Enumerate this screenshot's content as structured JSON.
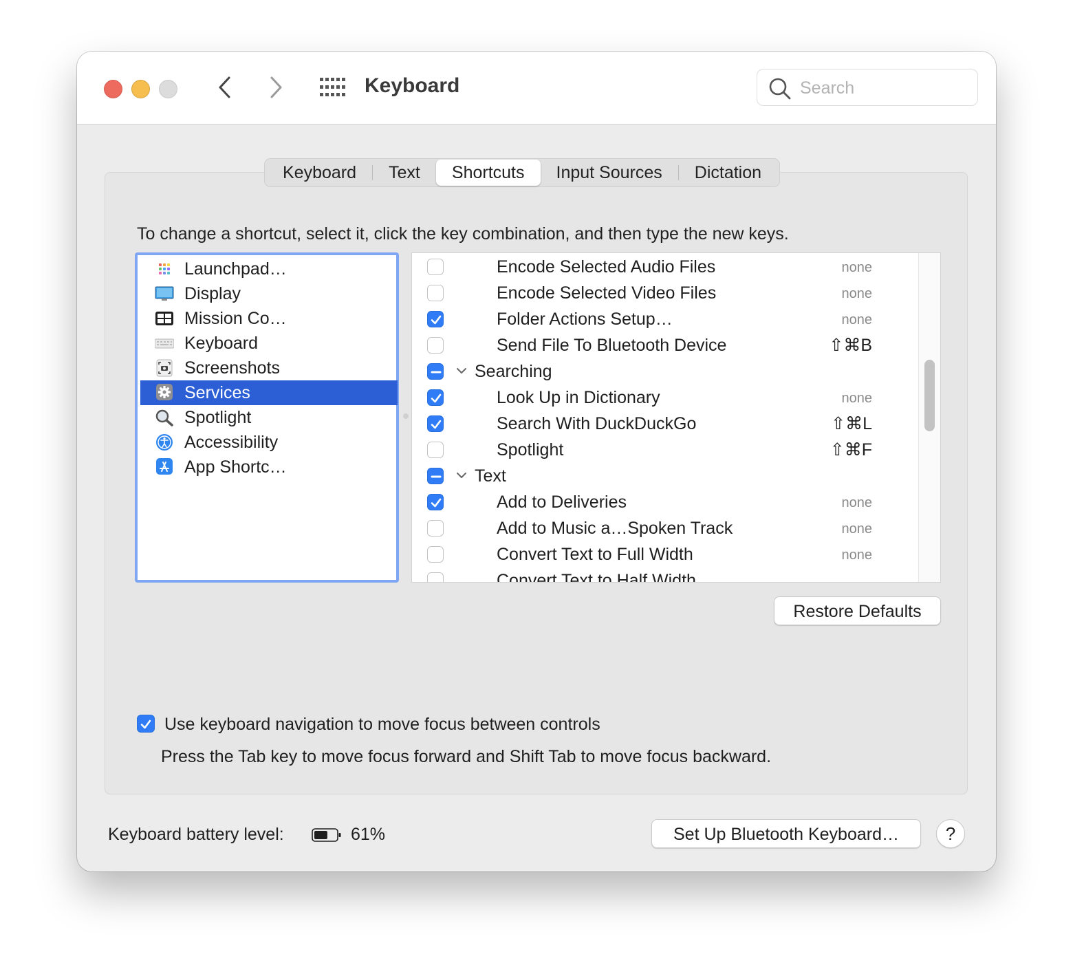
{
  "window": {
    "title": "Keyboard",
    "search_placeholder": "Search"
  },
  "tabs": [
    {
      "label": "Keyboard",
      "active": false
    },
    {
      "label": "Text",
      "active": false
    },
    {
      "label": "Shortcuts",
      "active": true
    },
    {
      "label": "Input Sources",
      "active": false
    },
    {
      "label": "Dictation",
      "active": false
    }
  ],
  "instruction": "To change a shortcut, select it, click the key combination, and then type the new keys.",
  "categories": [
    {
      "label": "Launchpad…",
      "icon": "launchpad-icon"
    },
    {
      "label": "Display",
      "icon": "display-icon"
    },
    {
      "label": "Mission Co…",
      "icon": "mission-control-icon"
    },
    {
      "label": "Keyboard",
      "icon": "keyboard-icon"
    },
    {
      "label": "Screenshots",
      "icon": "screenshot-icon"
    },
    {
      "label": "Services",
      "icon": "gear-icon",
      "selected": true
    },
    {
      "label": "Spotlight",
      "icon": "magnifier-icon"
    },
    {
      "label": "Accessibility",
      "icon": "accessibility-icon"
    },
    {
      "label": "App Shortc…",
      "icon": "app-store-icon"
    }
  ],
  "services": [
    {
      "name": "Encode Selected Audio Files",
      "state": "unchecked",
      "shortcut": "none"
    },
    {
      "name": "Encode Selected Video Files",
      "state": "unchecked",
      "shortcut": "none"
    },
    {
      "name": "Folder Actions Setup…",
      "state": "checked",
      "shortcut": "none"
    },
    {
      "name": "Send File To Bluetooth Device",
      "state": "unchecked",
      "shortcut": "⇧⌘B"
    },
    {
      "name": "Searching",
      "state": "mixed",
      "group": true
    },
    {
      "name": "Look Up in Dictionary",
      "state": "checked",
      "shortcut": "none"
    },
    {
      "name": "Search With DuckDuckGo",
      "state": "checked",
      "shortcut": "⇧⌘L"
    },
    {
      "name": "Spotlight",
      "state": "unchecked",
      "shortcut": "⇧⌘F"
    },
    {
      "name": "Text",
      "state": "mixed",
      "group": true
    },
    {
      "name": "Add to Deliveries",
      "state": "checked",
      "shortcut": "none"
    },
    {
      "name": "Add to Music a…Spoken Track",
      "state": "unchecked",
      "shortcut": "none"
    },
    {
      "name": "Convert Text to Full Width",
      "state": "unchecked",
      "shortcut": "none"
    },
    {
      "name": "Convert Text to Half Width",
      "state": "unchecked",
      "shortcut": ""
    }
  ],
  "buttons": {
    "restore_defaults": "Restore Defaults",
    "setup_bluetooth": "Set Up Bluetooth Keyboard…",
    "help": "?"
  },
  "keyboard_navigation": {
    "checked": true,
    "label": "Use keyboard navigation to move focus between controls",
    "hint": "Press the Tab key to move focus forward and Shift Tab to move focus backward."
  },
  "battery": {
    "label": "Keyboard battery level:",
    "level": 0.61,
    "percent_text": "61%"
  },
  "colors": {
    "accent": "#2f7cf6",
    "selection": "#2c5fd6",
    "focus_ring": "#7fa6f3",
    "close": "#ed6a5e",
    "minimize": "#f5be4f"
  }
}
